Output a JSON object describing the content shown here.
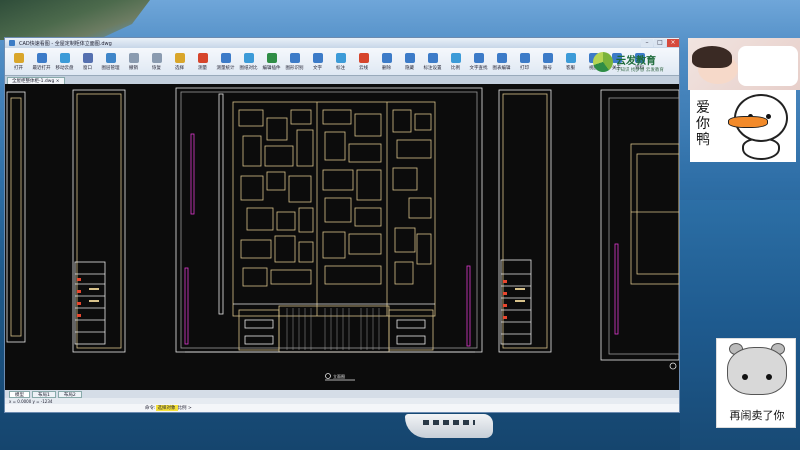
{
  "window": {
    "title": "CAD快速看图 - 全屋定制柜体立面图.dwg",
    "controls": [
      "–",
      "□",
      "×"
    ]
  },
  "toolbar": {
    "items": [
      {
        "label": "打开",
        "icon": "folder-icon",
        "color": "#d9a62b"
      },
      {
        "label": "最近打开",
        "icon": "recent-icon",
        "color": "#3c7bc8"
      },
      {
        "label": "移动云盘",
        "icon": "cloud-icon",
        "color": "#3c9bd8"
      },
      {
        "label": "窗口",
        "icon": "window-icon",
        "color": "#5570b0"
      },
      {
        "label": "图层管理",
        "icon": "layers-icon",
        "color": "#3f86c9"
      },
      {
        "label": "撤销",
        "icon": "undo-icon",
        "color": "#8a9bb0"
      },
      {
        "label": "恢复",
        "icon": "redo-icon",
        "color": "#8a9bb0"
      },
      {
        "label": "选择",
        "icon": "select-icon",
        "color": "#d9a62b"
      },
      {
        "label": "测量",
        "icon": "measure-icon",
        "color": "#d6452c"
      },
      {
        "label": "测量统计",
        "icon": "stats-icon",
        "color": "#3c7bc8"
      },
      {
        "label": "图纸对比",
        "icon": "compare-icon",
        "color": "#3c9bd8"
      },
      {
        "label": "编辑插件",
        "icon": "plugin-icon",
        "color": "#2f8d46"
      },
      {
        "label": "图形识别",
        "icon": "recognize-icon",
        "color": "#3c7bc8"
      },
      {
        "label": "文字",
        "icon": "text-icon",
        "color": "#3c7bc8"
      },
      {
        "label": "标注",
        "icon": "dimension-icon",
        "color": "#3c9bd8"
      },
      {
        "label": "云线",
        "icon": "revcloud-icon",
        "color": "#d6452c"
      },
      {
        "label": "删除",
        "icon": "delete-icon",
        "color": "#3c7bc8"
      },
      {
        "label": "隐藏",
        "icon": "hide-icon",
        "color": "#3c7bc8"
      },
      {
        "label": "标注设置",
        "icon": "settings-icon",
        "color": "#3c7bc8"
      },
      {
        "label": "比例",
        "icon": "scale-icon",
        "color": "#3c9bd8"
      },
      {
        "label": "文字查找",
        "icon": "find-icon",
        "color": "#3c7bc8"
      },
      {
        "label": "图表编辑",
        "icon": "table-icon",
        "color": "#3c7bc8"
      },
      {
        "label": "打印",
        "icon": "print-icon",
        "color": "#3c7bc8"
      },
      {
        "label": "账号",
        "icon": "account-icon",
        "color": "#3c7bc8"
      },
      {
        "label": "客服",
        "icon": "support-icon",
        "color": "#3c9bd8"
      },
      {
        "label": "视图",
        "icon": "view-icon",
        "color": "#3c7bc8"
      },
      {
        "label": "关于",
        "icon": "about-icon",
        "color": "#3c7bc8"
      },
      {
        "label": "资料",
        "icon": "docs-icon",
        "color": "#3c7bc8"
      }
    ]
  },
  "brand": {
    "name": "云发教育",
    "tag": "学知识 找梦想 云发教育"
  },
  "doctab": {
    "label": "全屋柜整体柜-1.dwg ×"
  },
  "layout_tabs": [
    "模型",
    "布局1",
    "布局2"
  ],
  "status": {
    "coords": "x = 0.0000  y = -1234"
  },
  "command": {
    "prefix": "命令:",
    "highlight": "选择对象",
    "suffix": "比例 >"
  },
  "drawing": {
    "title_mark": "立面图",
    "colors": {
      "frame": "#e8e8e8",
      "outline": "#d8c28a",
      "accent": "#e03ad0",
      "annot": "#e8462e",
      "dim": "#5fe07a"
    }
  },
  "stickers": {
    "duck_text": "爱你鸭",
    "hamster_text": "再闹卖了你"
  }
}
